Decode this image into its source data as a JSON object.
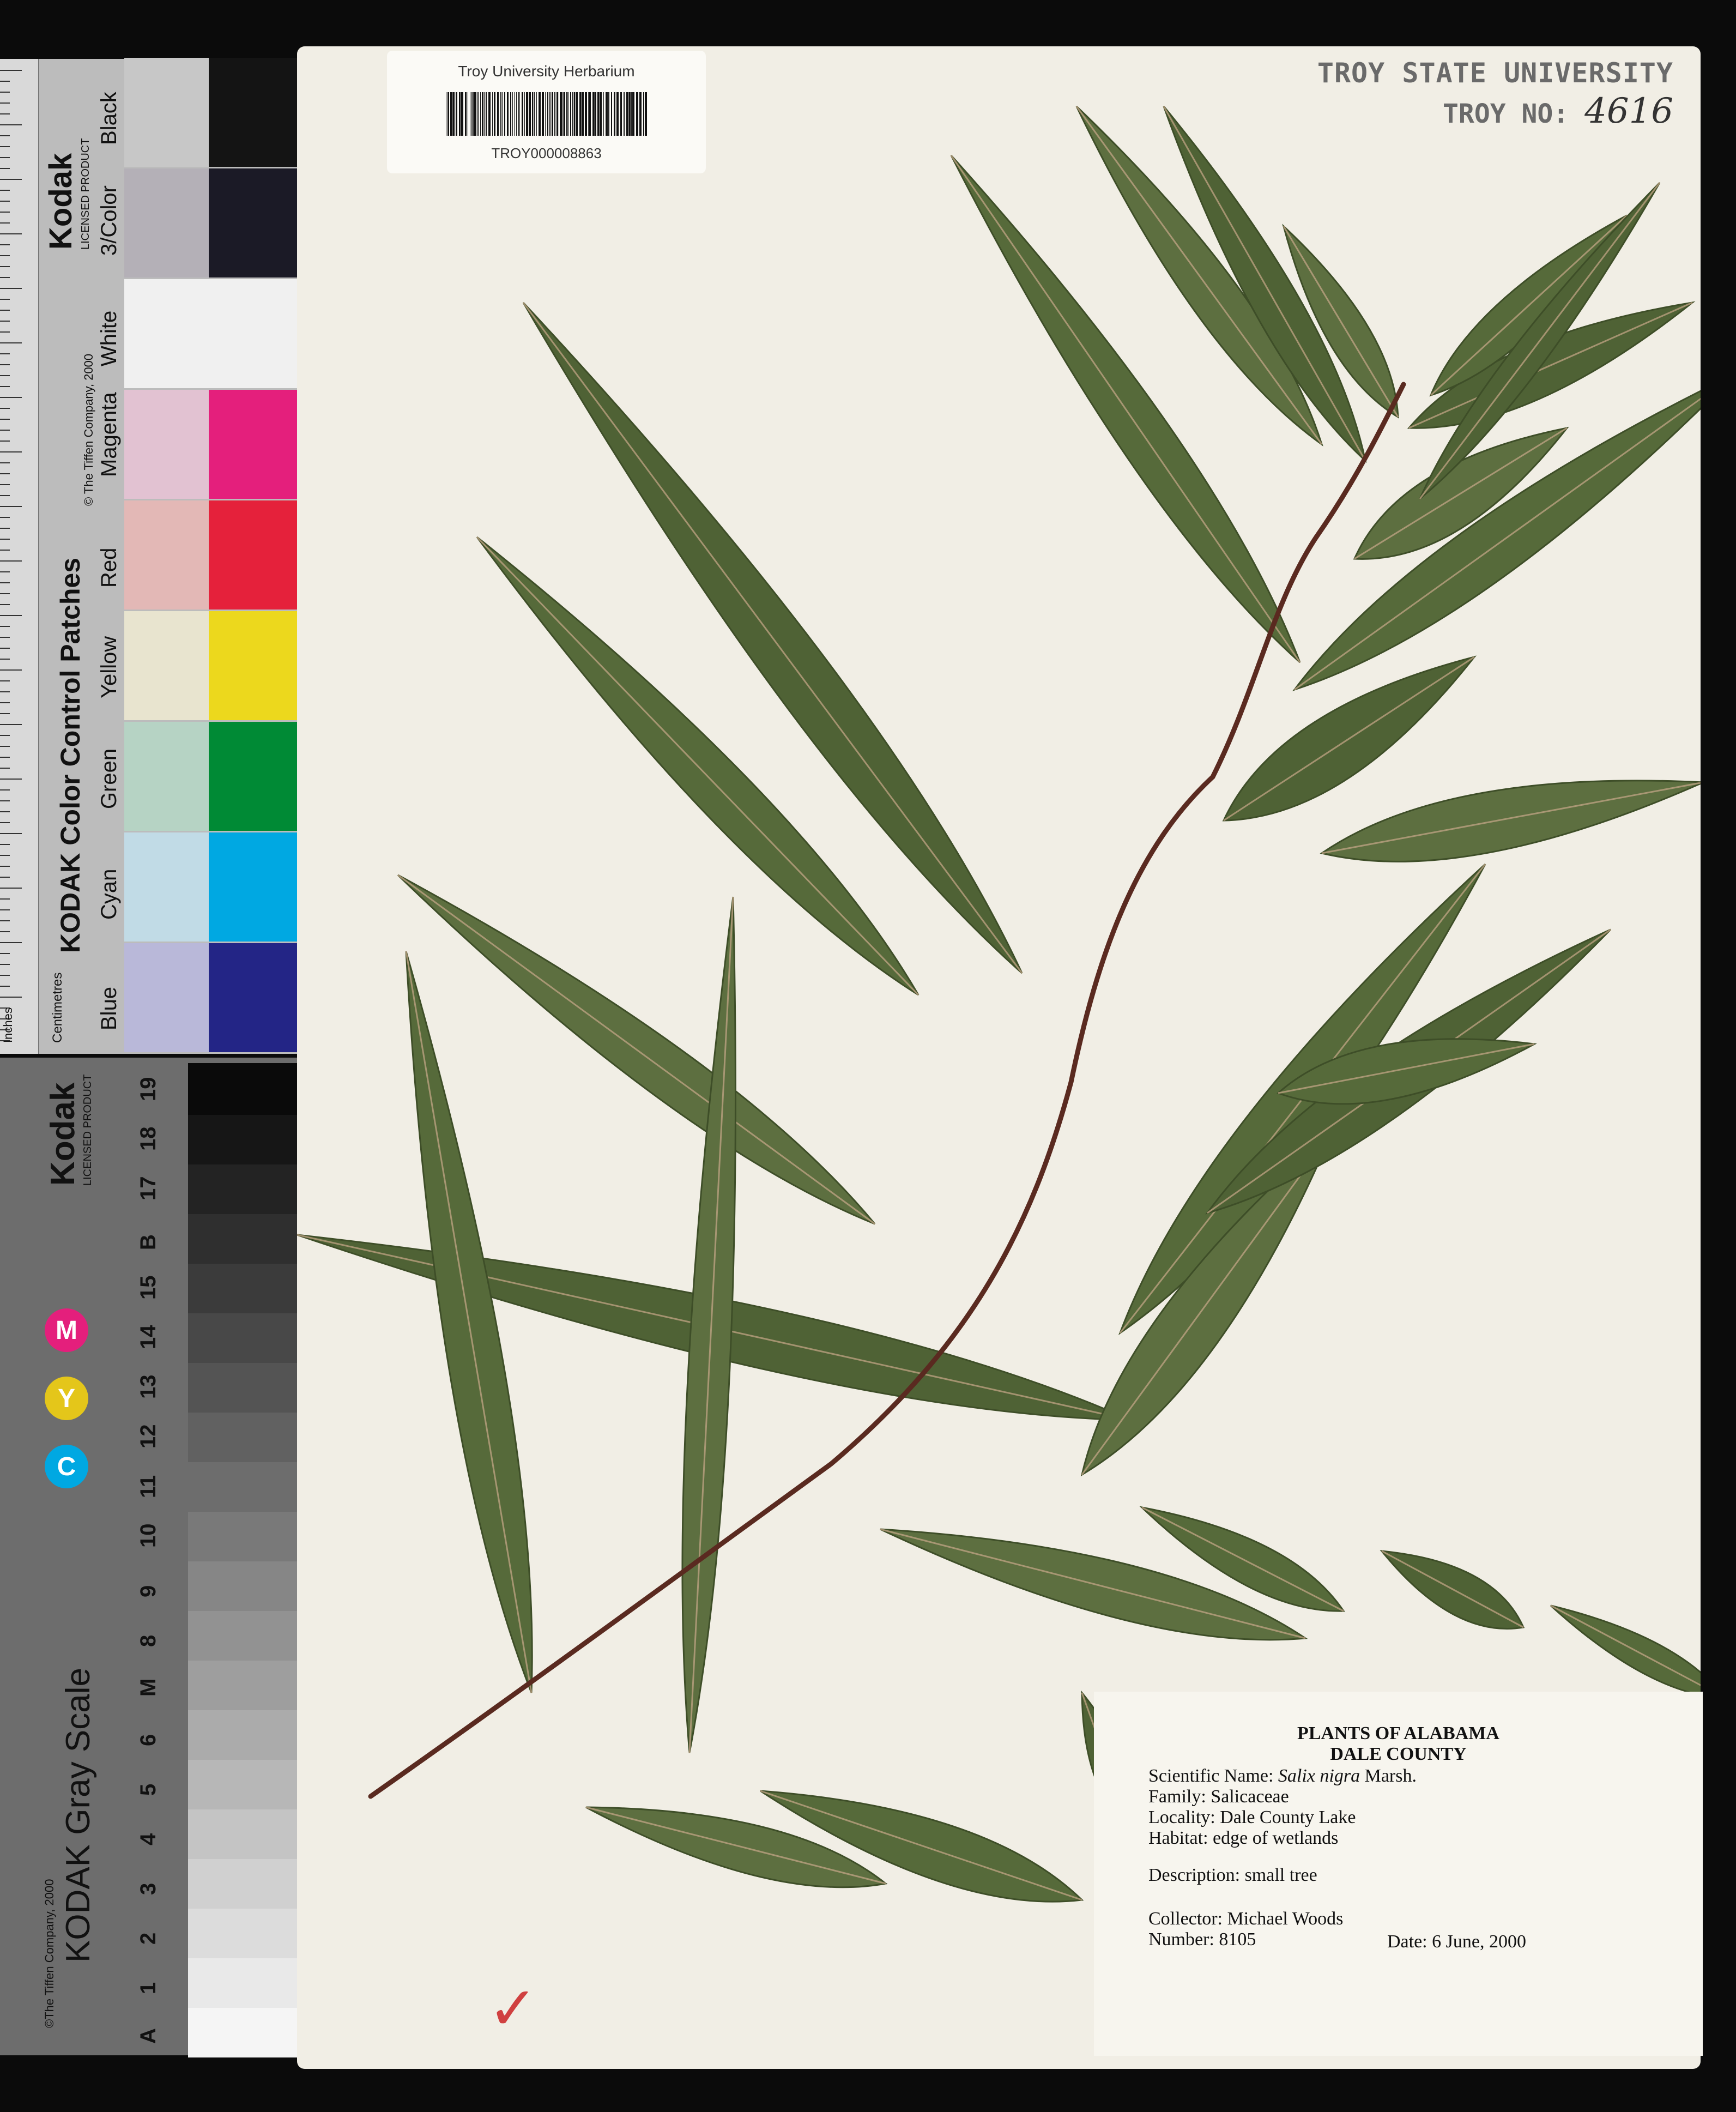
{
  "color_scale": {
    "brand": "Kodak",
    "licensed": "LICENSED PRODUCT",
    "title": "KODAK Color Control Patches",
    "copyright": "© The Tiffen Company, 2000",
    "units": [
      "Inches",
      "Centimetres"
    ],
    "patches": [
      {
        "label": "Blue",
        "light": "#b9b8d9",
        "dark": "#232586"
      },
      {
        "label": "Cyan",
        "light": "#c1dbe6",
        "dark": "#00a8e2"
      },
      {
        "label": "Green",
        "light": "#b6d3c4",
        "dark": "#008a35"
      },
      {
        "label": "Yellow",
        "light": "#e8e4cf",
        "dark": "#ecd81d"
      },
      {
        "label": "Red",
        "light": "#e3b8b6",
        "dark": "#e5213b"
      },
      {
        "label": "Magenta",
        "light": "#e2c2d2",
        "dark": "#e41f7c"
      },
      {
        "label": "White",
        "light": "#f0f0f0",
        "dark": "#f0f0f0"
      },
      {
        "label": "3/Color",
        "light": "#b4b0b7",
        "dark": "#1b1a26"
      },
      {
        "label": "Black",
        "light": "#c7c7c7",
        "dark": "#141414"
      }
    ]
  },
  "gray_scale": {
    "brand": "Kodak",
    "licensed": "LICENSED PRODUCT",
    "title": "KODAK Gray Scale",
    "copyright": "©The Tiffen Company, 2000",
    "steps": [
      "A",
      "1",
      "2",
      "3",
      "4",
      "5",
      "6",
      "M",
      "8",
      "9",
      "10",
      "11",
      "12",
      "13",
      "14",
      "15",
      "B",
      "17",
      "18",
      "19"
    ],
    "cym": [
      "C",
      "Y",
      "M"
    ]
  },
  "sheet": {
    "barcode_institution": "Troy University Herbarium",
    "barcode_number": "TROY000008863",
    "stamp_line1": "TROY STATE UNIVERSITY",
    "stamp_line2": "TROY NO:",
    "stamp_number": "4616"
  },
  "specimen_label": {
    "heading1": "PLANTS OF ALABAMA",
    "heading2": "DALE COUNTY",
    "sci_label": "Scientific Name:",
    "sci_name": "Salix nigra",
    "sci_author": "Marsh.",
    "family": "Family:  Salicaceae",
    "locality": "Locality: Dale County Lake",
    "habitat": "Habitat: edge of wetlands",
    "description": "Description: small tree",
    "collector": "Collector:  Michael Woods",
    "number": "Number: 8105",
    "date": "Date: 6 June, 2000"
  }
}
